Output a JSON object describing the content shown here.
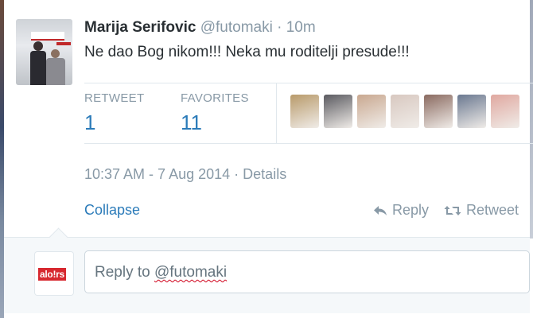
{
  "tweet": {
    "author_name": "Marija Serifovic",
    "handle": "@futomaki",
    "separator": "·",
    "time_ago": "10m",
    "text": "Ne dao Bog nikom!!! Neka mu roditelji presude!!!"
  },
  "stats": {
    "retweet_label": "RETWEET",
    "retweet_count": "1",
    "favorites_label": "FAVORITES",
    "favorites_count": "11"
  },
  "favoriters_colors": [
    "#b89a6a",
    "#5a5a60",
    "#c9a890",
    "#d8c8c0",
    "#8a6a60",
    "#6a7890",
    "#e0a8a0"
  ],
  "meta": {
    "timestamp": "10:37 AM - 7 Aug 2014",
    "separator": "·",
    "details_label": "Details"
  },
  "actions": {
    "collapse_label": "Collapse",
    "reply_label": "Reply",
    "retweet_label": "Retweet"
  },
  "reply": {
    "prefix": "Reply to ",
    "mention": "@futomaki"
  },
  "user_logo": {
    "text": "alo!rs"
  },
  "colors": {
    "link": "#2b7bb9",
    "muted": "#8899a6",
    "text": "#292f33"
  }
}
